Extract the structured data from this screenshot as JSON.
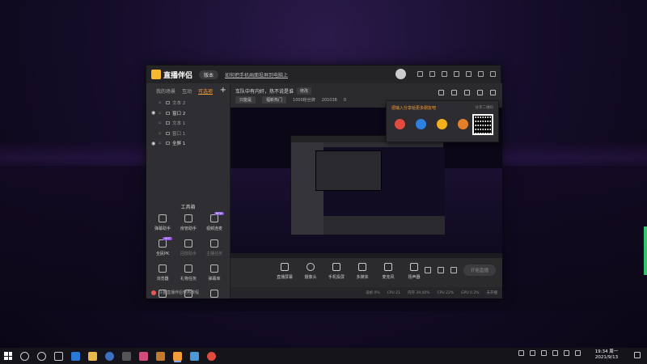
{
  "app": {
    "name": "直播伴侣",
    "version_pill": "版本",
    "title_link": "如何把手机画面投屏到电脑上"
  },
  "left_panel": {
    "tabs": [
      "我的场景",
      "互动",
      "可选项"
    ],
    "add_label": "+",
    "scenes": [
      {
        "label": "文本 2",
        "visible": false
      },
      {
        "label": "窗口 2",
        "visible": true
      },
      {
        "label": "文本 1",
        "visible": false
      },
      {
        "label": "窗口 1",
        "visible": false
      },
      {
        "label": "全屏 1",
        "visible": true
      }
    ],
    "tools_title": "工具箱",
    "tools": [
      {
        "label": "弹幕助手",
        "badge": ""
      },
      {
        "label": "房管助手",
        "badge": ""
      },
      {
        "label": "视频连麦",
        "badge": "NEW"
      },
      {
        "label": "全民PK",
        "badge": "HOT"
      },
      {
        "label": "回放助手",
        "badge": ""
      },
      {
        "label": "主播任务",
        "badge": ""
      },
      {
        "label": "浏览器",
        "badge": ""
      },
      {
        "label": "礼物任务",
        "badge": ""
      },
      {
        "label": "弹幕库",
        "badge": ""
      },
      {
        "label": "",
        "badge": ""
      },
      {
        "label": "",
        "badge": ""
      },
      {
        "label": "",
        "badge": ""
      }
    ],
    "helper_text": "斗鱼直播伴侣使用教程"
  },
  "main_header": {
    "room_title": "车队中有内奸，热不说是谁",
    "modify_label": "修改",
    "category_chip": "只能是",
    "hot_chip": "福新热门",
    "fans": "1000粉丝牌",
    "room_no": "201038",
    "heat": "0"
  },
  "share_popup": {
    "title": "把输入分享给更多朋友吧",
    "tag": "分享二维码"
  },
  "controls": {
    "items": [
      "直播屏幕",
      "摄像头",
      "手机投屏",
      "多媒体",
      "麦克风",
      "扬声器"
    ],
    "start_label": "开始直播"
  },
  "status_bar": {
    "items": [
      "丢帧 0%",
      "CPU 21",
      "内存 39.00%",
      "CPU 22%",
      "GPU 0.2%",
      "未开播"
    ]
  },
  "taskbar": {
    "time": "19:34 周一",
    "date": "2021/9/13"
  },
  "colors": {
    "accent": "#f39c3a",
    "badge": "#8b4fe6",
    "bg": "#2b2b2e"
  }
}
